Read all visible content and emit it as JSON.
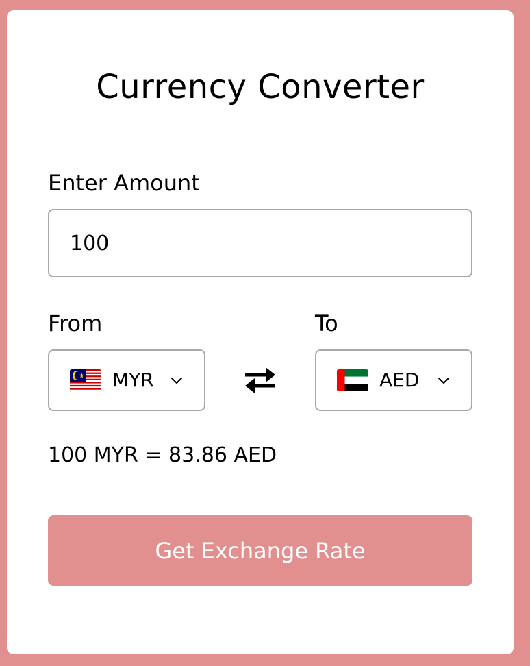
{
  "app": {
    "title": "Currency Converter"
  },
  "amount": {
    "label": "Enter Amount",
    "value": "100"
  },
  "from": {
    "label": "From",
    "currency": "MYR",
    "flag_icon": "malaysia-flag-icon"
  },
  "to": {
    "label": "To",
    "currency": "AED",
    "flag_icon": "uae-flag-icon"
  },
  "swap_icon": "swap-arrows-icon",
  "result": {
    "text": "100 MYR = 83.86 AED"
  },
  "button": {
    "label": "Get Exchange Rate"
  },
  "colors": {
    "background": "#e28f90",
    "button": "#e28f90",
    "card": "#ffffff",
    "border": "#a8a8a8"
  }
}
